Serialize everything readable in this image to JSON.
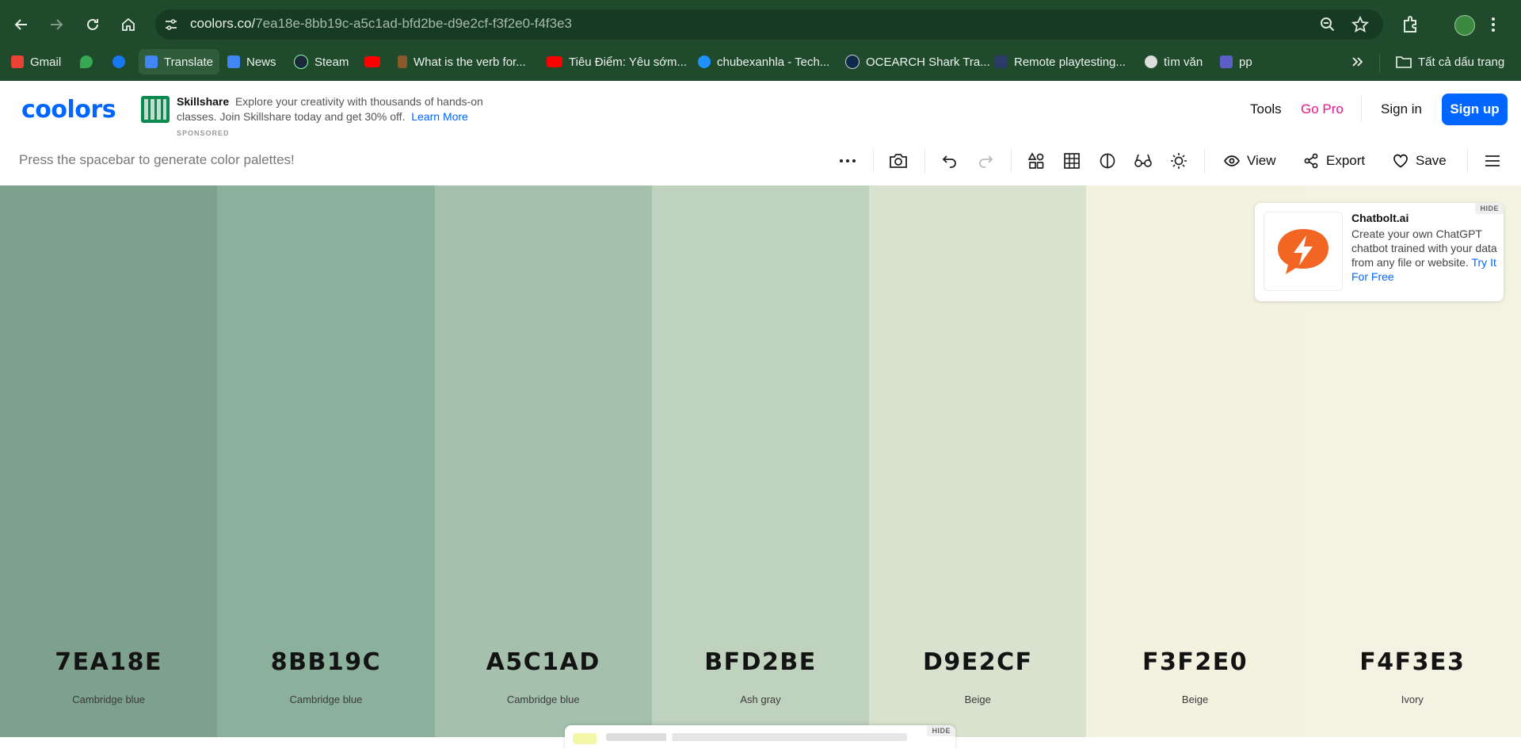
{
  "browser": {
    "url_host": "coolors.co/",
    "url_path": "7ea18e-8bb19c-a5c1ad-bfd2be-d9e2cf-f3f2e0-f4f3e3",
    "bookmarks": [
      {
        "label": "Gmail",
        "color": "#ea4335"
      },
      {
        "label": "",
        "color": "#34a853"
      },
      {
        "label": "",
        "color": "#1877f2"
      },
      {
        "label": "Translate",
        "color": "#4285f4"
      },
      {
        "label": "News",
        "color": "#4285f4"
      },
      {
        "label": "Steam",
        "color": "#1b2838"
      },
      {
        "label": "",
        "color": "#ff0000"
      },
      {
        "label": "What is the verb for...",
        "color": "#8b5a2b"
      },
      {
        "label": "Tiêu Điểm: Yêu sớm...",
        "color": "#ff0000"
      },
      {
        "label": "chubexanhla - Tech...",
        "color": "#1e90ff"
      },
      {
        "label": "OCEARCH Shark Tra...",
        "color": "#0d2a4a"
      },
      {
        "label": "Remote playtesting...",
        "color": "#2b3a67"
      },
      {
        "label": "tìm văn",
        "color": "#dddddd"
      },
      {
        "label": "pp",
        "color": "#5b5fc7"
      }
    ],
    "all_bookmarks": "Tất cả dấu trang"
  },
  "header": {
    "logo": "coolors",
    "ad": {
      "brand": "Skillshare",
      "text": "Explore your creativity with thousands of hands-on classes. Join Skillshare today and get 30% off.",
      "link": "Learn More",
      "sponsored": "SPONSORED"
    },
    "tools": "Tools",
    "go_pro": "Go Pro",
    "sign_in": "Sign in",
    "sign_up": "Sign up"
  },
  "toolbar": {
    "hint": "Press the spacebar to generate color palettes!",
    "view": "View",
    "export": "Export",
    "save": "Save"
  },
  "palette": [
    {
      "hex": "7EA18E",
      "name": "Cambridge blue",
      "color": "#7ea18e"
    },
    {
      "hex": "8BB19C",
      "name": "Cambridge blue",
      "color": "#8bb19c"
    },
    {
      "hex": "A5C1AD",
      "name": "Cambridge blue",
      "color": "#a5c1ad"
    },
    {
      "hex": "BFD2BE",
      "name": "Ash gray",
      "color": "#bfd2be"
    },
    {
      "hex": "D9E2CF",
      "name": "Beige",
      "color": "#d9e2cf"
    },
    {
      "hex": "F3F2E0",
      "name": "Beige",
      "color": "#f3f2e0"
    },
    {
      "hex": "F4F3E3",
      "name": "Ivory",
      "color": "#f4f3e3"
    }
  ],
  "side_ad": {
    "title": "Chatbolt.ai",
    "text": "Create your own ChatGPT chatbot trained with your data from any file or website.",
    "link": "Try It For Free",
    "hide": "HIDE"
  },
  "bottom_ad": {
    "hide": "HIDE"
  }
}
